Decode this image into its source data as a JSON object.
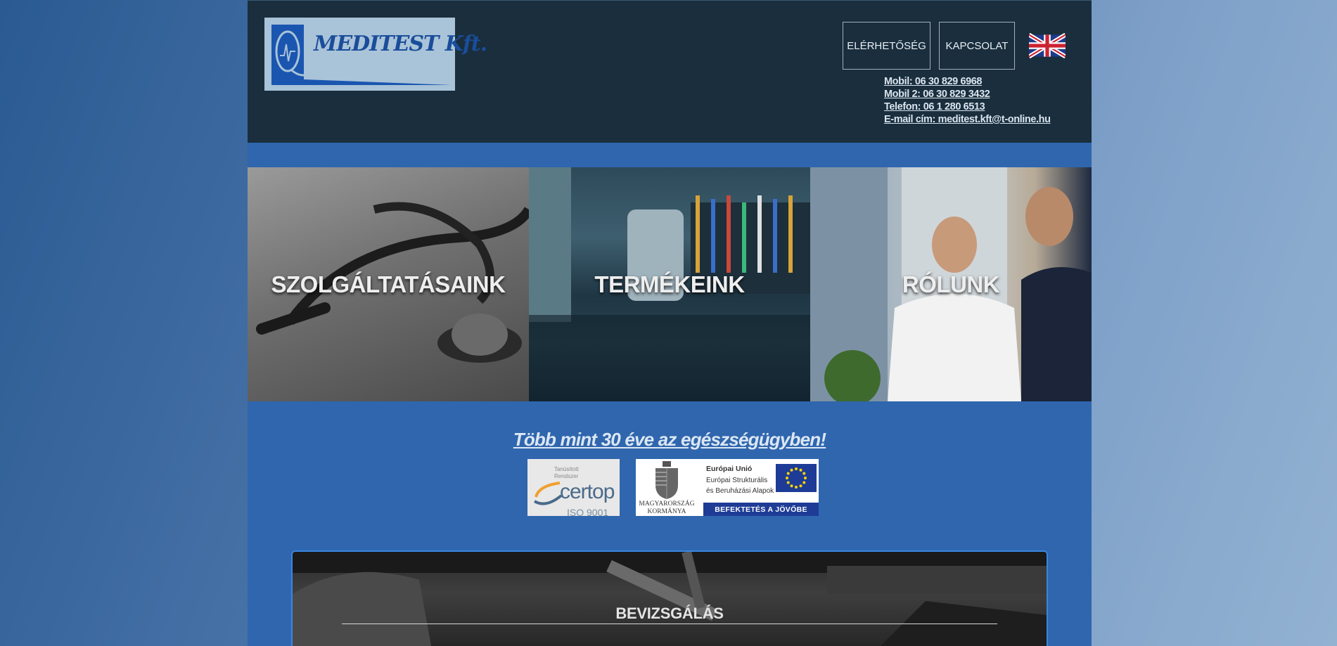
{
  "brand": {
    "logo_text": "MEDITEST Kft.",
    "logo_alt": "Meditest Kft. logo"
  },
  "nav": {
    "availability": "ELÉRHETŐSÉG",
    "contact": "KAPCSOLAT",
    "language_icon": "uk-flag-icon"
  },
  "contacts": {
    "mobile": "Mobil: 06 30 829 6968",
    "mobile2": "Mobil 2: 06 30 829 3432",
    "phone": "Telefon: 06 1 280 6513",
    "email": "E-mail cím: meditest.kft@t-online.hu"
  },
  "tiles": [
    {
      "label": "SZOLGÁLTATÁSAINK"
    },
    {
      "label": "TERMÉKEINK"
    },
    {
      "label": "RÓLUNK"
    }
  ],
  "tagline": "Több mint 30 éve az egészségügyben!",
  "certificates": {
    "iso": {
      "line1": "Tanúsított",
      "line2": "Rendszer",
      "brand": "certop",
      "standard": "ISO 9001"
    },
    "eu": {
      "heading": "Európai Unió",
      "line1": "Európai Strukturális",
      "line2": "és Beruházási Alapok",
      "gov1": "MAGYARORSZÁG",
      "gov2": "KORMÁNYA",
      "slogan": "BEFEKTETÉS A JÖVŐBE"
    }
  },
  "panel": {
    "title": "BEVIZSGÁLÁS"
  },
  "colors": {
    "header_bg": "#1a2e3d",
    "page_bg": "#2f66ae",
    "panel_border": "#3a86e0"
  }
}
